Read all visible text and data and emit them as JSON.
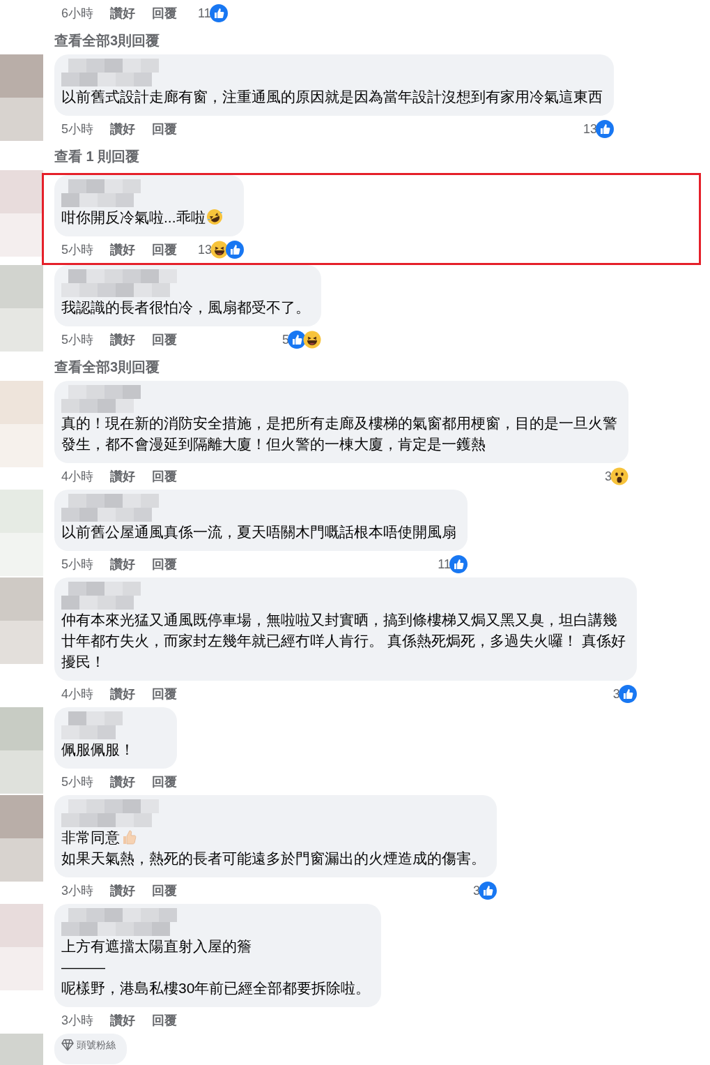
{
  "items": [
    {
      "kind": "meta",
      "time": "6小時",
      "like": "讚好",
      "reply": "回覆",
      "reaction_count": "11",
      "reactions": [
        {
          "kind": "like"
        }
      ]
    },
    {
      "kind": "more-replies",
      "label": "查看全部3則回覆"
    },
    {
      "kind": "comment",
      "lines": [
        {
          "text": "以前舊式設計走廊有窗，注重通風的原因就是因為當年設計沒想到有家用冷氣這東西"
        }
      ],
      "time": "5小時",
      "like": "讚好",
      "reply": "回覆",
      "reaction_count": "13",
      "reactions": [
        {
          "kind": "like"
        }
      ]
    },
    {
      "kind": "more-replies",
      "label": "查看 1 則回覆"
    },
    {
      "kind": "comment",
      "highlighted": true,
      "lines": [
        {
          "text": "咁你開反冷氣啦...乖啦",
          "emoji": {
            "kind": "rofl"
          }
        }
      ],
      "time": "5小時",
      "like": "讚好",
      "reply": "回覆",
      "reaction_count": "13",
      "reactions": [
        {
          "kind": "haha"
        },
        {
          "kind": "like"
        }
      ]
    },
    {
      "kind": "comment",
      "lines": [
        {
          "text": "我認識的長者很怕冷，風扇都受不了。"
        }
      ],
      "time": "5小時",
      "like": "讚好",
      "reply": "回覆",
      "reaction_count": "5",
      "reactions": [
        {
          "kind": "like"
        },
        {
          "kind": "haha"
        }
      ]
    },
    {
      "kind": "more-replies",
      "label": "查看全部3則回覆"
    },
    {
      "kind": "comment",
      "lines": [
        {
          "text": "真的！現在新的消防安全措施，是把所有走廊及樓梯的氣窗都用梗窗，目的是一旦火警"
        },
        {
          "text": "發生，都不會漫延到隔離大廈！但火警的一棟大廈，肯定是一鑊熱"
        }
      ],
      "time": "4小時",
      "like": "讚好",
      "reply": "回覆",
      "reaction_count": "3",
      "reactions": [
        {
          "kind": "wow"
        }
      ]
    },
    {
      "kind": "comment",
      "lines": [
        {
          "text": "以前舊公屋通風真係一流，夏天唔關木門嘅話根本唔使開風扇"
        }
      ],
      "time": "5小時",
      "like": "讚好",
      "reply": "回覆",
      "reaction_count": "11",
      "reactions": [
        {
          "kind": "like"
        }
      ]
    },
    {
      "kind": "comment",
      "lines": [
        {
          "text": "仲有本來光猛又通風既停車場，無啦啦又封實晒，搞到條樓梯又焗又黑又臭，坦白講幾"
        },
        {
          "text": "廿年都冇失火，而家封左幾年就已經冇咩人肯行。 真係熱死焗死，多過失火囉！ 真係好"
        },
        {
          "text": "擾民！"
        }
      ],
      "time": "4小時",
      "like": "讚好",
      "reply": "回覆",
      "reaction_count": "3",
      "reactions": [
        {
          "kind": "like"
        }
      ]
    },
    {
      "kind": "comment",
      "lines": [
        {
          "text": "佩服佩服！"
        }
      ],
      "time": "5小時",
      "like": "讚好",
      "reply": "回覆"
    },
    {
      "kind": "comment",
      "lines": [
        {
          "text": "非常同意",
          "emoji": {
            "kind": "thumb"
          }
        },
        {
          "text": "如果天氣熱，熱死的長者可能遠多於門窗漏出的火煙造成的傷害。"
        }
      ],
      "time": "3小時",
      "like": "讚好",
      "reply": "回覆",
      "reaction_count": "3",
      "reactions": [
        {
          "kind": "like"
        }
      ]
    },
    {
      "kind": "comment",
      "lines": [
        {
          "text": "上方有遮擋太陽直射入屋的簷"
        },
        {
          "text": "———"
        },
        {
          "text": "呢樣野，港島私樓30年前已經全部都要拆除啦。"
        }
      ],
      "time": "3小時",
      "like": "讚好",
      "reply": "回覆"
    },
    {
      "kind": "comment",
      "badge": "頭號粉絲"
    }
  ]
}
